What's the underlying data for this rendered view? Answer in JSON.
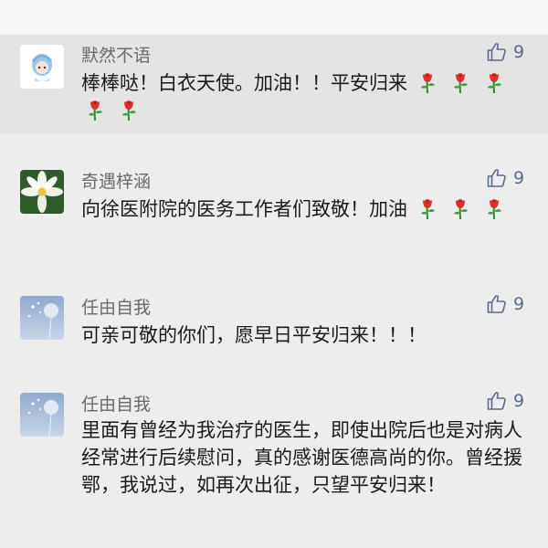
{
  "comments": [
    {
      "name": "默然不语",
      "likes": "9",
      "avatar": "cartoon-girl-avatar",
      "segments": [
        "棒棒哒！白衣天使。加油！！平安归来"
      ],
      "roses": 5
    },
    {
      "name": "奇遇梓涵",
      "likes": "9",
      "avatar": "white-flower-avatar",
      "segments": [
        "向徐医附院的医务工作者们致敬！加油"
      ],
      "roses": 3
    },
    {
      "name": "任由自我",
      "likes": "9",
      "avatar": "dandelion-avatar",
      "segments": [
        "可亲可敬的你们，愿早日平安归来！！！"
      ],
      "roses": 0
    },
    {
      "name": "任由自我",
      "likes": "9",
      "avatar": "dandelion-avatar",
      "segments": [
        "里面有曾经为我治疗的医生，即使出院后也是对病人经常进行后续慰问，真的感谢医德高尚的你。曾经援鄂，我说过，如再次出征，只望平安归来！"
      ],
      "roses": 0
    }
  ],
  "colors": {
    "name": "#6a6a6a",
    "like": "#5b6b8c",
    "text": "#1a1a1a",
    "highlight": "#e4e4e4",
    "background": "#ededed"
  },
  "icons": [
    "thumbs-up-icon",
    "rose-emoji-icon"
  ]
}
